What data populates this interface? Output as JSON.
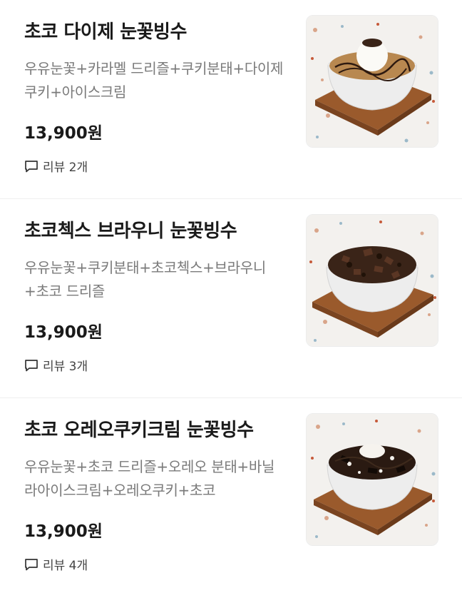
{
  "menu": {
    "items": [
      {
        "name": "초코 다이제 눈꽃빙수",
        "description": "우유눈꽃+카라멜 드리즐+쿠키분태+다이제쿠키+아이스크림",
        "price": "13,900원",
        "review": "리뷰 2개",
        "image_icon": "bingsu-photo"
      },
      {
        "name": "초코첵스 브라우니 눈꽃빙수",
        "description": "우유눈꽃+쿠키분태+초코첵스+브라우니+초코 드리즐",
        "price": "13,900원",
        "review": "리뷰 3개",
        "image_icon": "bingsu-photo"
      },
      {
        "name": "초코 오레오쿠키크림 눈꽃빙수",
        "description": "우유눈꽃+초코 드리즐+오레오 분태+바닐라아이스크림+오레오쿠키+초코",
        "price": "13,900원",
        "review": "리뷰 4개",
        "image_icon": "bingsu-photo"
      }
    ]
  },
  "colors": {
    "text_primary": "#1a1a1a",
    "text_secondary": "#7a7a7a",
    "divider": "#efefef"
  },
  "icons": {
    "review": "speech-bubble-icon"
  }
}
